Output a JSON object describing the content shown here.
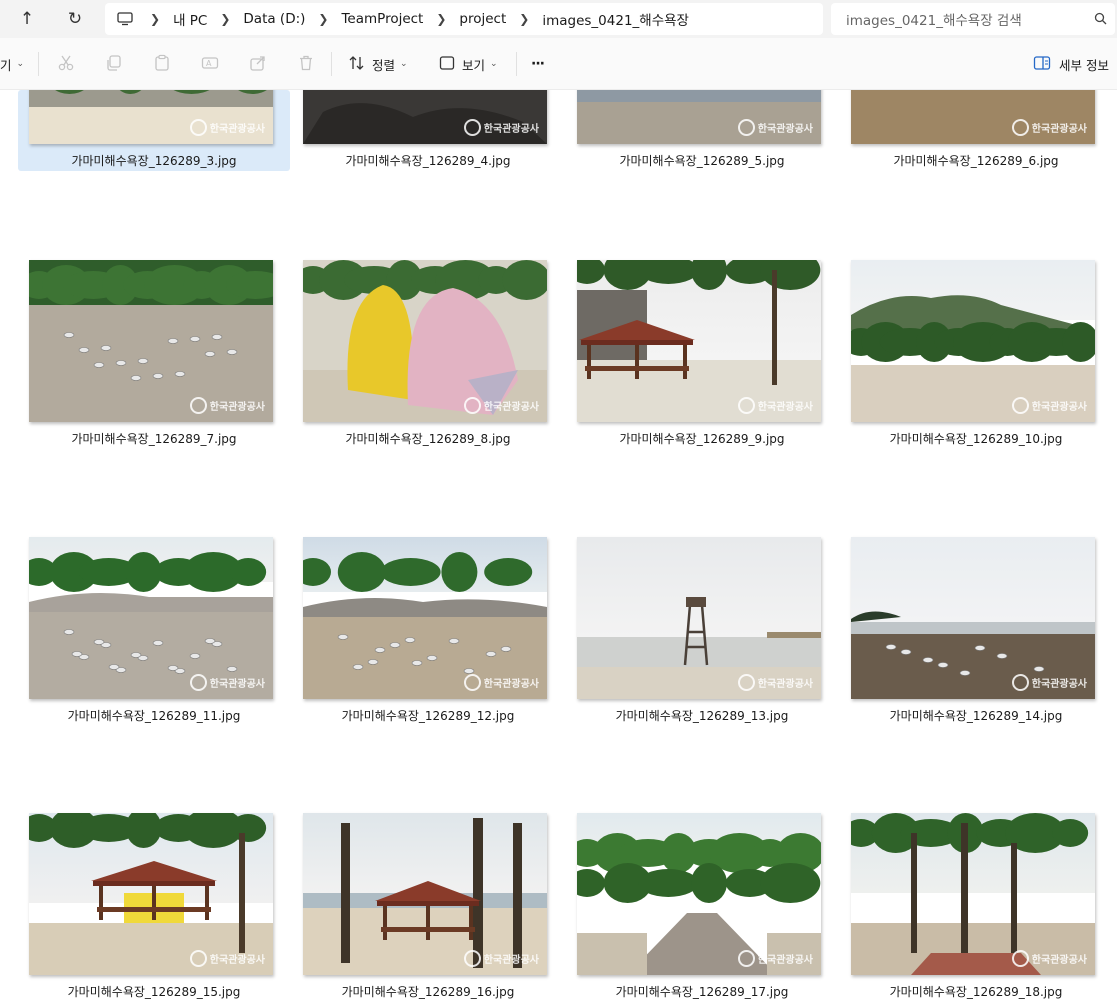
{
  "nav": {
    "up_label": "↑",
    "refresh_label": "↻"
  },
  "breadcrumb": {
    "items": [
      "내 PC",
      "Data (D:)",
      "TeamProject",
      "project",
      "images_0421_해수욕장"
    ]
  },
  "search": {
    "placeholder": "images_0421_해수욕장 검색"
  },
  "toolbar": {
    "left_cut_label": "기",
    "sort_label": "정렬",
    "view_label": "보기",
    "more_label": "···",
    "details_label": "세부 정보"
  },
  "watermark": "한국관광공사",
  "files": [
    {
      "name": "가마미해수욕장_126289_3.jpg",
      "scene": "beach_wall",
      "selected": true
    },
    {
      "name": "가마미해수욕장_126289_4.jpg",
      "scene": "rocks"
    },
    {
      "name": "가마미해수욕장_126289_5.jpg",
      "scene": "water_flat"
    },
    {
      "name": "가마미해수욕장_126289_6.jpg",
      "scene": "sand_flat"
    },
    {
      "name": "가마미해수욕장_126289_7.jpg",
      "scene": "gulls_hill"
    },
    {
      "name": "가마미해수욕장_126289_8.jpg",
      "scene": "climbing_rock"
    },
    {
      "name": "가마미해수욕장_126289_9.jpg",
      "scene": "pavilion_pines"
    },
    {
      "name": "가마미해수욕장_126289_10.jpg",
      "scene": "mountain_beach"
    },
    {
      "name": "가마미해수욕장_126289_11.jpg",
      "scene": "gulls_cliff"
    },
    {
      "name": "가마미해수욕장_126289_12.jpg",
      "scene": "gulls_island"
    },
    {
      "name": "가마미해수욕장_126289_13.jpg",
      "scene": "lifeguard_tower"
    },
    {
      "name": "가마미해수욕장_126289_14.jpg",
      "scene": "mudflat_birds"
    },
    {
      "name": "가마미해수욕장_126289_15.jpg",
      "scene": "gazebo_trees"
    },
    {
      "name": "가마미해수욕장_126289_16.jpg",
      "scene": "gazebo_beach"
    },
    {
      "name": "가마미해수욕장_126289_17.jpg",
      "scene": "path_trees"
    },
    {
      "name": "가마미해수욕장_126289_18.jpg",
      "scene": "pine_grove"
    }
  ]
}
